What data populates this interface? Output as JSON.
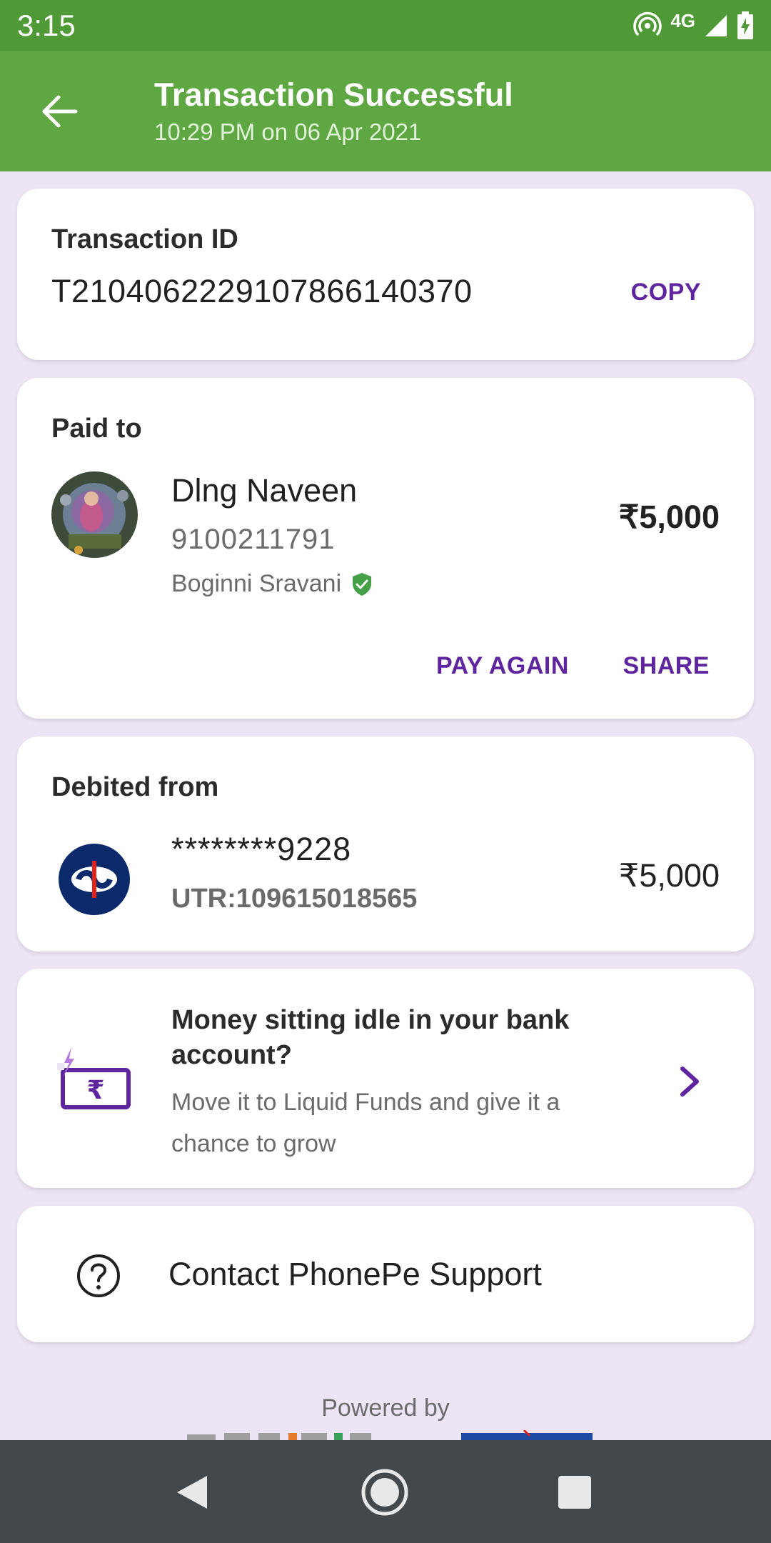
{
  "status_bar": {
    "time": "3:15",
    "network": "4G",
    "icons": [
      "hotspot-icon",
      "signal-icon",
      "battery-charging-icon"
    ]
  },
  "app_bar": {
    "back_icon": "arrow-left-icon",
    "title": "Transaction Successful",
    "subtitle": "10:29 PM on 06 Apr 2021"
  },
  "transaction": {
    "label": "Transaction ID",
    "id": "T2104062229107866140370",
    "copy_label": "COPY"
  },
  "paid_to": {
    "label": "Paid to",
    "name": "Dlng Naveen",
    "phone": "9100211791",
    "bank_name": "Boginni Sravani",
    "verified_icon": "verified-shield-icon",
    "amount": "₹5,000",
    "pay_again_label": "PAY AGAIN",
    "share_label": "SHARE"
  },
  "debited_from": {
    "label": "Debited from",
    "account": "********9228",
    "utr": "UTR:109615018565",
    "amount": "₹5,000",
    "bank_icon": "kotak-bank-logo"
  },
  "promo": {
    "title": "Money sitting idle in your bank account?",
    "description": "Move it to Liquid Funds and give it a chance to grow",
    "icon": "rupee-wallet-icon",
    "chevron_icon": "chevron-right-icon"
  },
  "support": {
    "label": "Contact PhonePe Support",
    "icon": "help-circle-icon"
  },
  "footer": {
    "powered_by": "Powered by"
  },
  "colors": {
    "status_bar": "#4f9a36",
    "app_bar": "#5ea742",
    "background": "#ede5f5",
    "accent_purple": "#5f259f",
    "verified_green": "#43a047",
    "nav_bar": "#43484d"
  }
}
